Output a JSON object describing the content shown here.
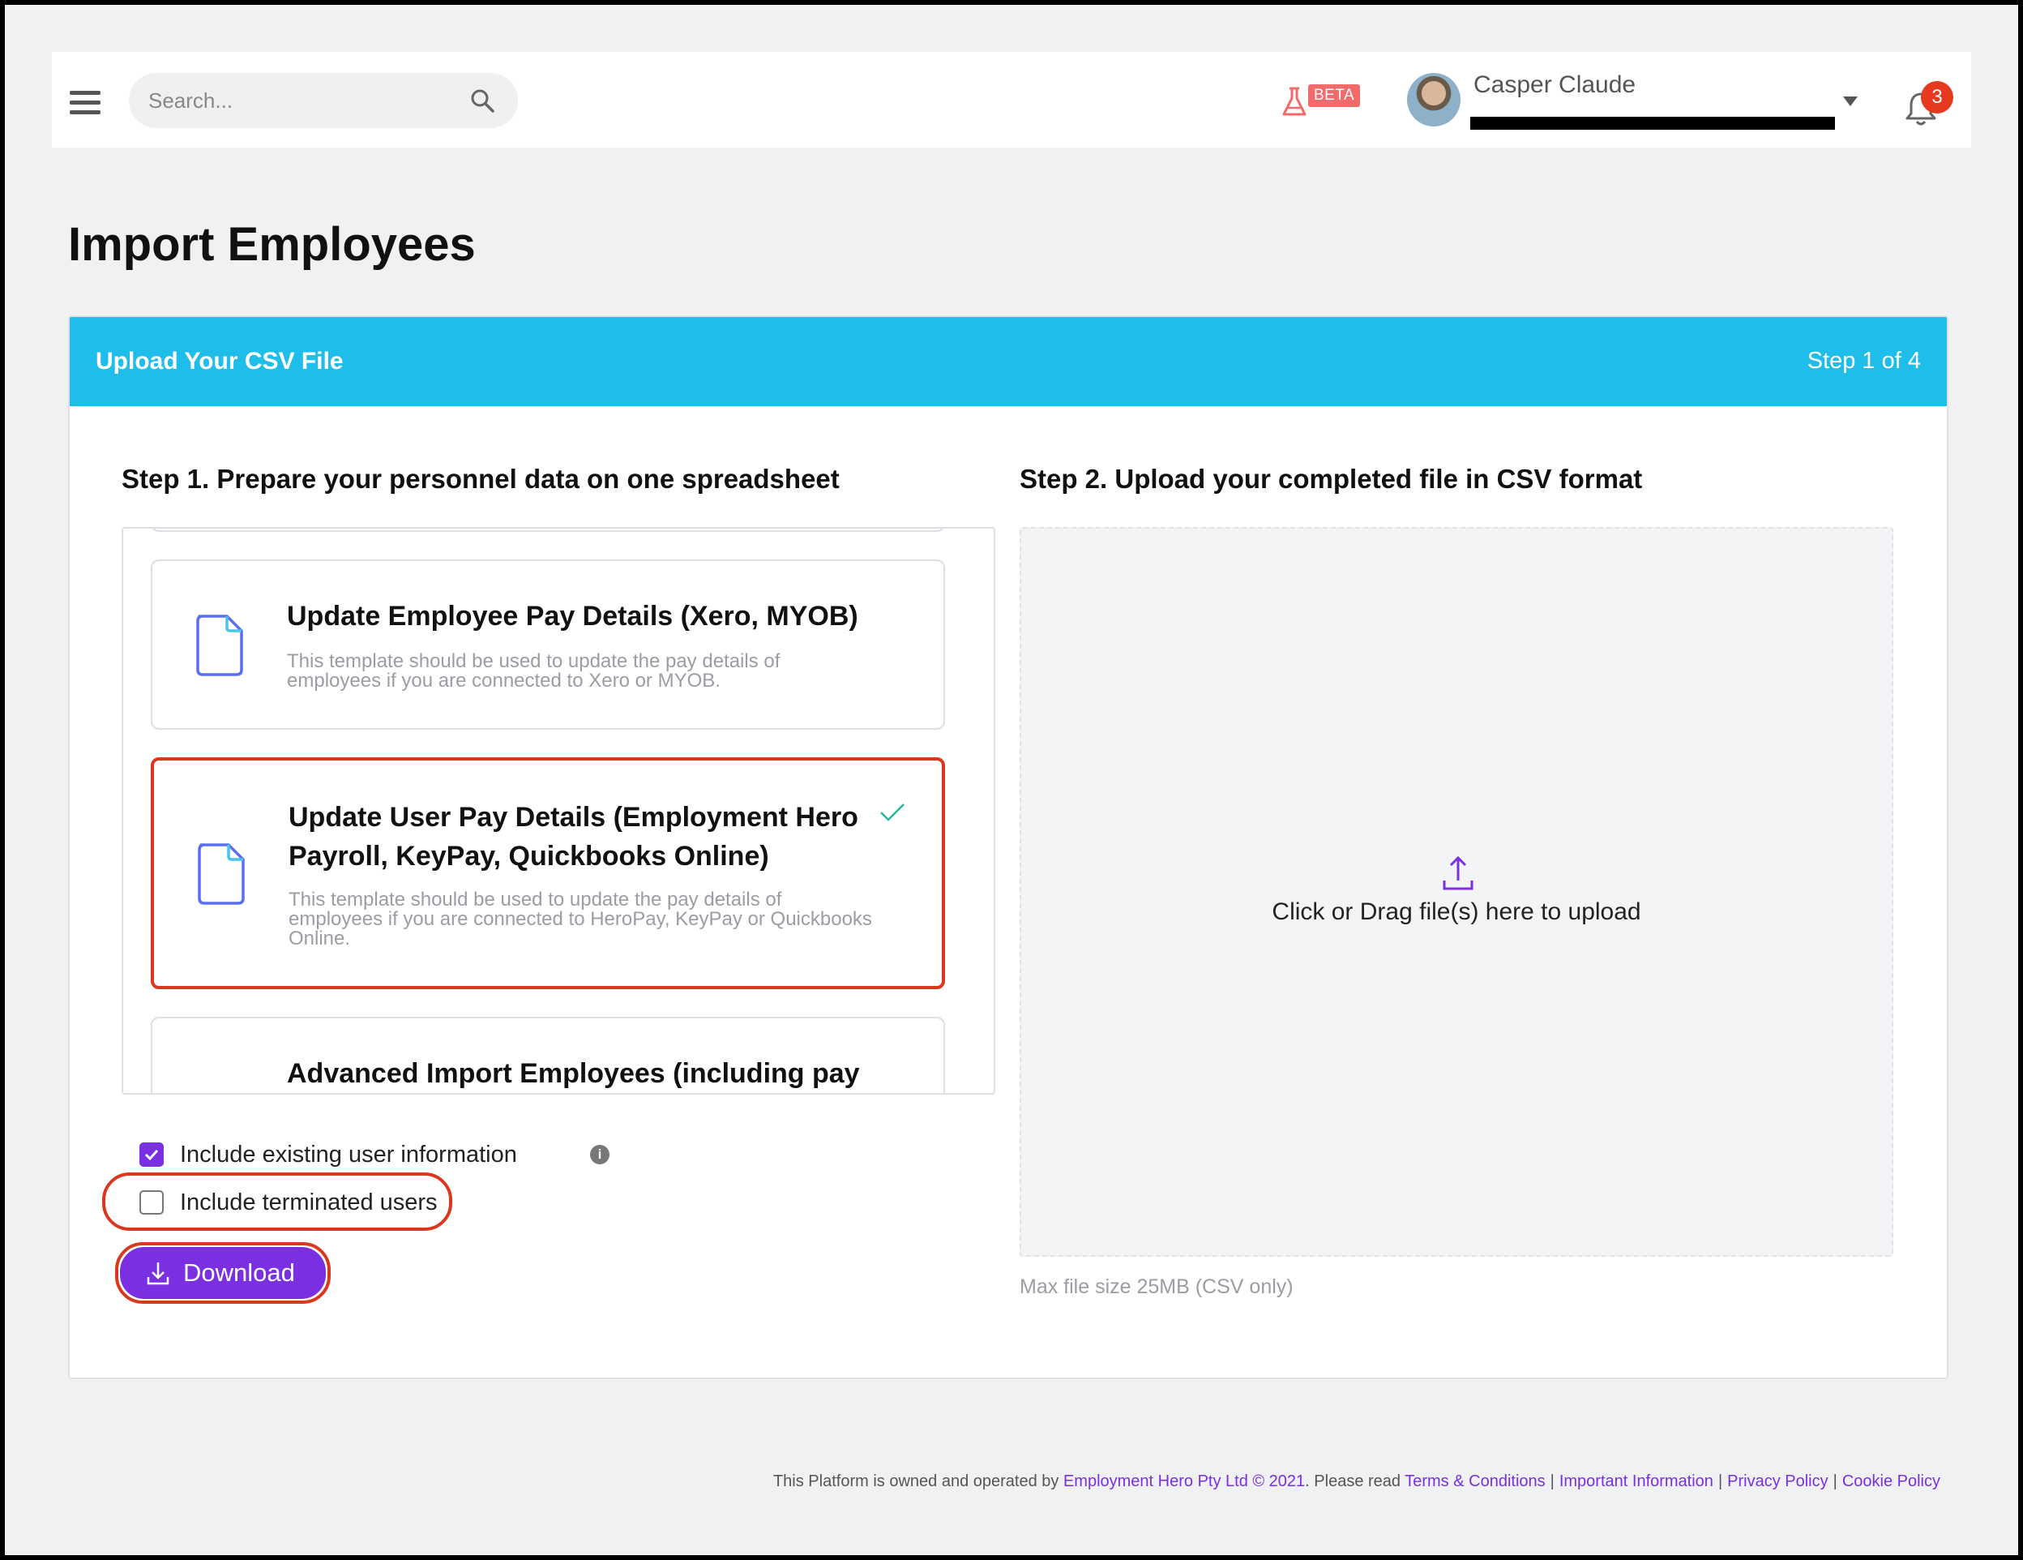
{
  "header": {
    "search_placeholder": "Search...",
    "beta_label": "BETA",
    "user_name": "Casper Claude",
    "notification_count": "3"
  },
  "page": {
    "title": "Import Employees"
  },
  "card": {
    "header_title": "Upload Your CSV File",
    "step_indicator": "Step 1 of 4",
    "step1_title": "Step 1. Prepare your personnel data on one spreadsheet",
    "step2_title": "Step 2. Upload your completed file in CSV format",
    "templates": [
      {
        "title": "Update Employee Pay Details (Xero, MYOB)",
        "description": "This template should be used to update the pay details of employees if you are connected to Xero or MYOB.",
        "selected": false
      },
      {
        "title": "Update User Pay Details (Employment Hero Payroll, KeyPay, Quickbooks Online)",
        "description": "This template should be used to update the pay details of employees if you are connected to HeroPay, KeyPay or Quickbooks Online.",
        "selected": true
      },
      {
        "title": "Advanced Import Employees (including pay",
        "description": "",
        "selected": false
      }
    ],
    "options": {
      "include_existing_label": "Include existing user information",
      "include_existing_checked": true,
      "include_terminated_label": "Include terminated users",
      "include_terminated_checked": false
    },
    "download_label": "Download",
    "dropzone_text": "Click or Drag file(s) here to upload",
    "max_size_text": "Max file size 25MB (CSV only)"
  },
  "footer": {
    "prefix": "This Platform is owned and operated by",
    "company_link": "Employment Hero Pty Ltd © 2021",
    "middle": ". Please read",
    "links": [
      "Terms & Conditions",
      "Important Information",
      "Privacy Policy",
      "Cookie Policy"
    ],
    "separator": "|"
  },
  "colors": {
    "accent_purple": "#7a2fe0",
    "header_blue": "#1fbde9",
    "highlight_red": "#d9381e",
    "badge_red": "#e63a1f"
  },
  "icons": [
    "menu-icon",
    "search-icon",
    "flask-icon",
    "bell-icon",
    "document-icon",
    "checkmark-icon",
    "info-icon",
    "download-icon",
    "upload-icon",
    "caret-down-icon"
  ]
}
